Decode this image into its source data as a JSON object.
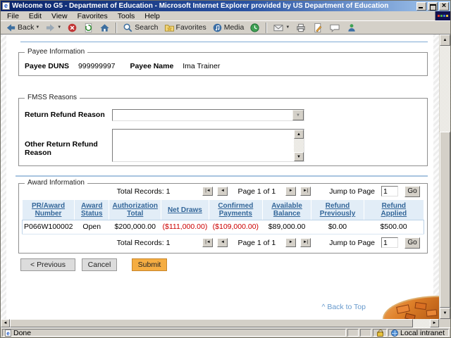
{
  "window": {
    "title": "Welcome to G5 - Department of Education - Microsoft Internet Explorer provided by US Department of Education",
    "menu": [
      "File",
      "Edit",
      "View",
      "Favorites",
      "Tools",
      "Help"
    ],
    "toolbar": {
      "back_label": "Back",
      "search_label": "Search",
      "favorites_label": "Favorites",
      "media_label": "Media"
    },
    "statusbar": {
      "status": "Done",
      "zone": "Local intranet"
    }
  },
  "page": {
    "payee": {
      "legend": "Payee Information",
      "duns_label": "Payee DUNS",
      "duns_value": "999999997",
      "name_label": "Payee Name",
      "name_value": "Ima Trainer"
    },
    "fmss": {
      "legend": "FMSS Reasons",
      "return_label": "Return Refund Reason",
      "return_value": "",
      "other_label": "Other Return Refund Reason",
      "other_value": ""
    },
    "award": {
      "legend": "Award Information",
      "pagination": {
        "total": "Total Records: 1",
        "page": "Page 1 of 1",
        "jump_label": "Jump to Page",
        "jump_value": "1",
        "go": "Go",
        "first": "|◄",
        "prev": "◄",
        "next": "►",
        "last": "►|"
      },
      "table": {
        "columns": [
          {
            "l1": "PR/Award",
            "l2": "Number"
          },
          {
            "l1": "Award",
            "l2": "Status"
          },
          {
            "l1": "Authorization",
            "l2": "Total"
          },
          {
            "l1": "Net Draws",
            "l2": ""
          },
          {
            "l1": "Confirmed",
            "l2": "Payments"
          },
          {
            "l1": "Available",
            "l2": "Balance"
          },
          {
            "l1": "Refund",
            "l2": "Previously"
          },
          {
            "l1": "Refund",
            "l2": "Applied"
          }
        ],
        "rows": [
          {
            "pr": "P066W100002",
            "status": "Open",
            "auth": "$200,000.00",
            "net": "($111,000.00)",
            "confirmed": "($109,000.00)",
            "available": "$89,000.00",
            "prev": "$0.00",
            "applied": "$500.00"
          }
        ]
      }
    },
    "actions": {
      "previous": "< Previous",
      "cancel": "Cancel",
      "submit": "Submit"
    },
    "back_to_top": "^ Back to Top"
  },
  "colors": {
    "accent_orange": "#F5AD42",
    "link_blue": "#336699",
    "negative_red": "#CC0000",
    "table_header_bg": "#E2EDF7",
    "rule_blue": "#7FA9D4"
  }
}
